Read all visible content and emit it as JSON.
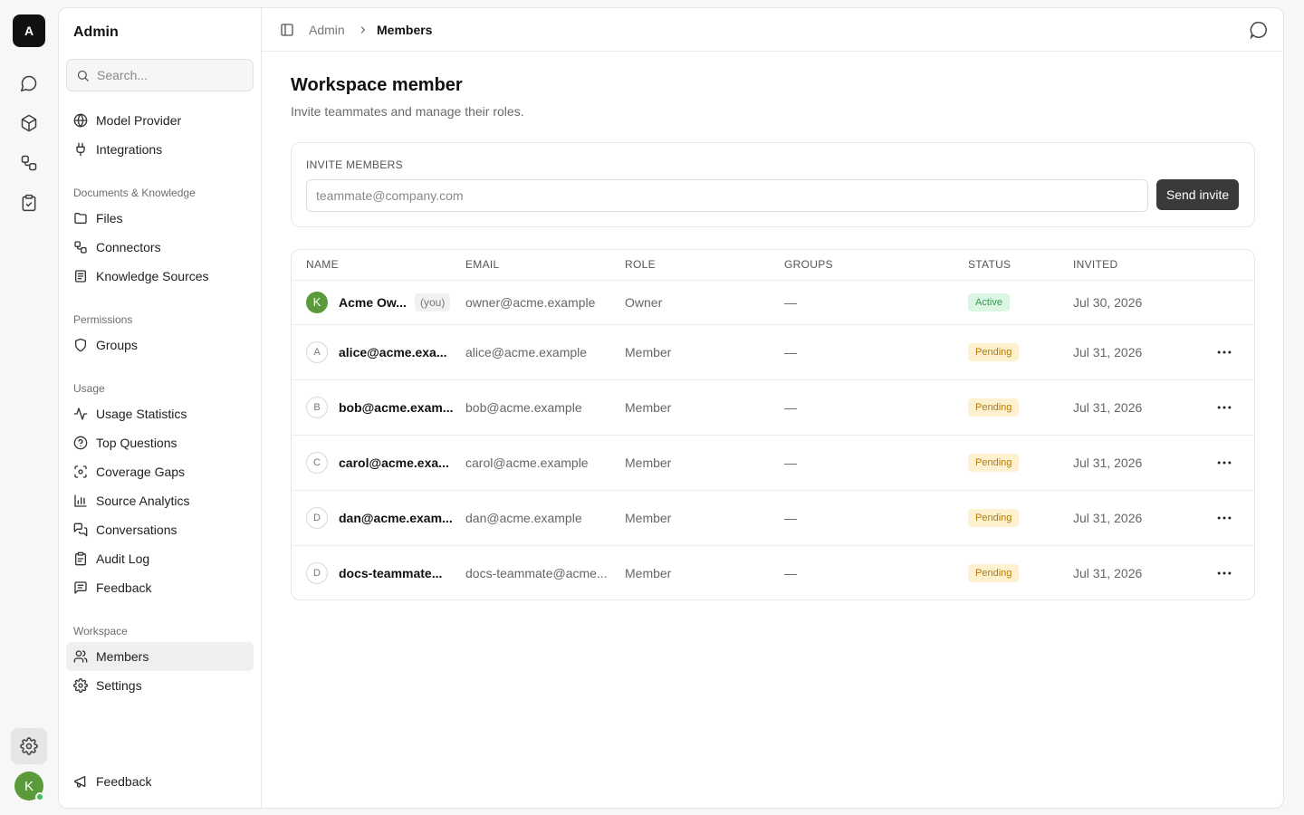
{
  "rail": {
    "logo_letter": "A",
    "icons": [
      "chat-icon",
      "cube-icon",
      "connectors-icon",
      "clipboard-check-icon"
    ],
    "settings_icon": "gear-icon",
    "avatar_letter": "K"
  },
  "sidebar": {
    "title": "Admin",
    "search_placeholder": "Search...",
    "top_items": [
      {
        "label": "Model Provider",
        "icon": "globe-icon"
      },
      {
        "label": "Integrations",
        "icon": "plug-icon"
      }
    ],
    "sections": [
      {
        "title": "Documents & Knowledge",
        "items": [
          {
            "label": "Files",
            "icon": "folder-icon"
          },
          {
            "label": "Connectors",
            "icon": "connectors-icon"
          },
          {
            "label": "Knowledge Sources",
            "icon": "book-icon"
          }
        ]
      },
      {
        "title": "Permissions",
        "items": [
          {
            "label": "Groups",
            "icon": "shield-icon"
          }
        ]
      },
      {
        "title": "Usage",
        "items": [
          {
            "label": "Usage Statistics",
            "icon": "activity-icon"
          },
          {
            "label": "Top Questions",
            "icon": "question-circle-icon"
          },
          {
            "label": "Coverage Gaps",
            "icon": "scan-icon"
          },
          {
            "label": "Source Analytics",
            "icon": "bar-chart-icon"
          },
          {
            "label": "Conversations",
            "icon": "messages-icon"
          },
          {
            "label": "Audit Log",
            "icon": "clipboard-icon"
          },
          {
            "label": "Feedback",
            "icon": "message-square-icon"
          }
        ]
      },
      {
        "title": "Workspace",
        "items": [
          {
            "label": "Members",
            "icon": "users-icon",
            "active": true
          },
          {
            "label": "Settings",
            "icon": "gear-icon"
          }
        ]
      }
    ],
    "bottom_item": {
      "label": "Feedback",
      "icon": "megaphone-icon"
    }
  },
  "header": {
    "breadcrumb": [
      "Admin",
      "Members"
    ],
    "toggle_icon": "sidebar-toggle-icon",
    "right_icon": "chat-bubble-icon"
  },
  "main": {
    "title": "Workspace member",
    "subtitle": "Invite teammates and manage their roles.",
    "invite": {
      "label": "INVITE MEMBERS",
      "placeholder": "teammate@company.com",
      "button": "Send invite"
    },
    "table": {
      "columns": [
        "NAME",
        "EMAIL",
        "ROLE",
        "GROUPS",
        "STATUS",
        "INVITED"
      ],
      "rows": [
        {
          "initial": "K",
          "name": "Acme Ow...",
          "you": "(you)",
          "email": "owner@acme.example",
          "role": "Owner",
          "groups": "—",
          "status": "Active",
          "invited": "Jul 30, 2026"
        },
        {
          "initial": "A",
          "name": "alice@acme.exa...",
          "email": "alice@acme.example",
          "role": "Member",
          "groups": "—",
          "status": "Pending",
          "invited": "Jul 31, 2026"
        },
        {
          "initial": "B",
          "name": "bob@acme.exam...",
          "email": "bob@acme.example",
          "role": "Member",
          "groups": "—",
          "status": "Pending",
          "invited": "Jul 31, 2026"
        },
        {
          "initial": "C",
          "name": "carol@acme.exa...",
          "email": "carol@acme.example",
          "role": "Member",
          "groups": "—",
          "status": "Pending",
          "invited": "Jul 31, 2026"
        },
        {
          "initial": "D",
          "name": "dan@acme.exam...",
          "email": "dan@acme.example",
          "role": "Member",
          "groups": "—",
          "status": "Pending",
          "invited": "Jul 31, 2026"
        },
        {
          "initial": "D",
          "name": "docs-teammate...",
          "email": "docs-teammate@acme...",
          "role": "Member",
          "groups": "—",
          "status": "Pending",
          "invited": "Jul 31, 2026"
        }
      ]
    }
  },
  "colors": {
    "accent_dark": "#3a3a3a",
    "active_bg": "#ddf5e3",
    "active_fg": "#2e9d4a",
    "pending_bg": "#fdf1cf",
    "pending_fg": "#b77a08",
    "avatar_green": "#5a9a3a"
  }
}
